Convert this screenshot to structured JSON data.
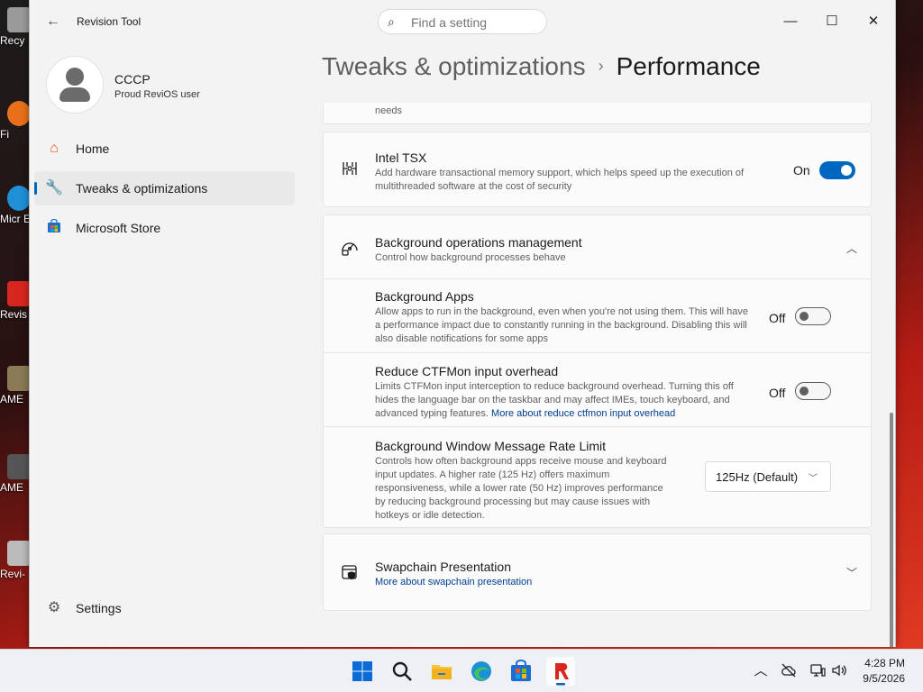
{
  "desktop": {
    "icons": [
      {
        "label": "Recy",
        "color": "#9a9a9a"
      },
      {
        "label": "Fi",
        "color": "#e8701a"
      },
      {
        "label": "Micr E",
        "color": "#1f8fd6"
      },
      {
        "label": "Revis",
        "color": "#d7261e"
      },
      {
        "label": "AME",
        "color": "#8a7a55"
      },
      {
        "label": "AME",
        "color": "#555555"
      },
      {
        "label": "Revi-",
        "color": "#bbbbbb"
      }
    ]
  },
  "window": {
    "title": "Revision Tool",
    "search_placeholder": "Find a setting",
    "controls": {
      "minimize": "—",
      "maximize": "☐",
      "close": "✕"
    }
  },
  "sidebar": {
    "profile": {
      "name": "CCCP",
      "subtitle": "Proud ReviOS user"
    },
    "items": [
      {
        "label": "Home",
        "icon": "home-icon",
        "active": false
      },
      {
        "label": "Tweaks & optimizations",
        "icon": "wrench-icon",
        "active": true
      },
      {
        "label": "Microsoft Store",
        "icon": "store-icon",
        "active": false
      }
    ],
    "settings_label": "Settings"
  },
  "main": {
    "breadcrumb": {
      "parent": "Tweaks & optimizations",
      "separator": "›",
      "current": "Performance"
    },
    "partial_card_text": "needs",
    "intel_tsx": {
      "title": "Intel TSX",
      "description": "Add hardware transactional memory support, which helps speed up the execution of multithreaded software at the cost of security",
      "toggle_label": "On",
      "enabled": true
    },
    "bg_ops": {
      "title": "Background operations management",
      "description": "Control how background processes behave",
      "expanded": true
    },
    "bg_apps": {
      "title": "Background Apps",
      "description": "Allow apps to run in the background, even when you're not using them. This will have a performance impact due to constantly running in the background. Disabling this will also disable notifications for some apps",
      "toggle_label": "Off",
      "enabled": false
    },
    "ctfmon": {
      "title": "Reduce CTFMon input overhead",
      "description": "Limits CTFMon input interception to reduce background overhead. Turning this off hides the language bar on the taskbar and may affect IMEs, touch keyboard, and advanced typing features.",
      "link": "More about reduce ctfmon input overhead",
      "toggle_label": "Off",
      "enabled": false
    },
    "msg_rate": {
      "title": "Background Window Message Rate Limit",
      "description": "Controls how often background apps receive mouse and keyboard input updates. A higher rate (125 Hz) offers maximum responsiveness, while a lower rate (50 Hz) improves performance by reducing background processing but may cause issues with hotkeys or idle detection.",
      "selected": "125Hz (Default)"
    },
    "swapchain": {
      "title": "Swapchain Presentation",
      "link": "More about swapchain presentation",
      "expanded": false
    }
  },
  "taskbar": {
    "time": "4:28 PM",
    "date": "9/5/2026",
    "colors": {
      "accent": "#0067c0",
      "revision": "#d7261e"
    }
  }
}
